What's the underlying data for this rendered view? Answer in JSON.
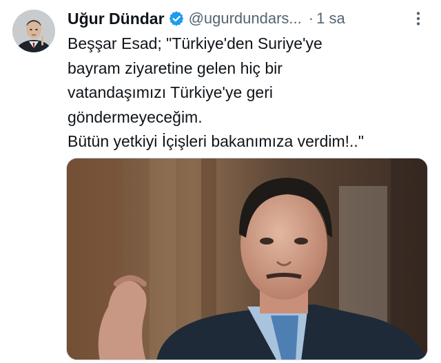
{
  "tweet": {
    "author": {
      "display_name": "Uğur Dündar",
      "handle": "@ugurdundars...",
      "verified": true,
      "avatar_icon": "profile-avatar"
    },
    "separator": "·",
    "timestamp": "1 sa",
    "more_icon": "more-vertical-icon",
    "text_lines": [
      "Beşşar Esad; \"Türkiye'den Suriye'ye",
      "bayram ziyaretine gelen hiç bir",
      "vatandaşımızı Türkiye'ye geri",
      "göndermeyeceğim.",
      "Bütün yetkiyi İçişleri bakanımıza verdim!..\""
    ],
    "media": {
      "type": "photo"
    }
  },
  "colors": {
    "text_primary": "#0f1419",
    "text_secondary": "#536471",
    "verified_blue": "#1d9bf0",
    "background": "#ffffff"
  }
}
